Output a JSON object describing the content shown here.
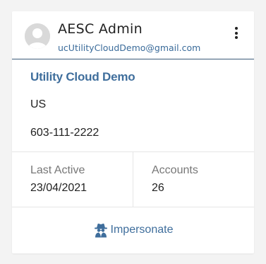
{
  "user": {
    "name": "AESC Admin",
    "email": "ucUtilityCloudDemo@gmail.com",
    "avatar_icon": "user-avatar-icon",
    "menu_icon": "kebab-menu-icon"
  },
  "company": {
    "name": "Utility Cloud Demo",
    "country": "US",
    "phone": "603-111-2222"
  },
  "stats": {
    "last_active_label": "Last Active",
    "last_active_value": "23/04/2021",
    "accounts_label": "Accounts",
    "accounts_value": "26"
  },
  "footer": {
    "impersonate_label": "Impersonate",
    "impersonate_icon": "spy-agent-icon"
  },
  "colors": {
    "accent": "#3f6e9c",
    "header_rule": "#3a5a78",
    "background": "#f3f3f3",
    "card": "#ffffff"
  }
}
